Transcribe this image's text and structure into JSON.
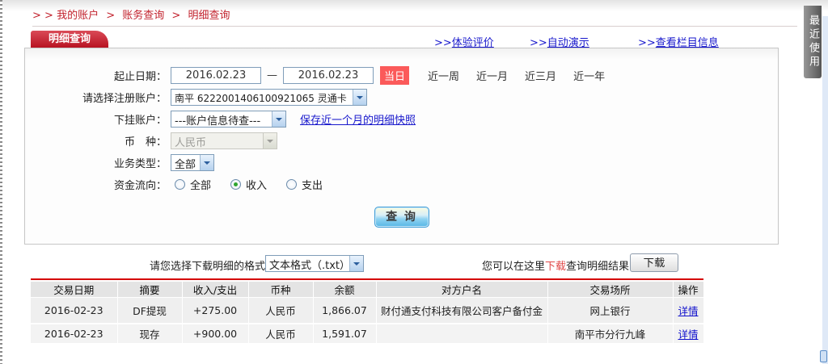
{
  "breadcrumb": {
    "prefix": "> >",
    "separator": ">",
    "items": [
      "我的账户",
      "账务查询",
      "明细查询"
    ]
  },
  "header": {
    "tab": "明细查询",
    "links": [
      {
        "prefix": ">>",
        "label": "体验评价"
      },
      {
        "prefix": ">>",
        "label": "自动演示"
      },
      {
        "prefix": ">>",
        "label": "查看栏目信息"
      }
    ]
  },
  "form": {
    "date": {
      "label": "起止日期：",
      "from": "2016.02.23",
      "dash": "—",
      "to": "2016.02.23",
      "today_badge": "当日",
      "ranges": [
        "近一周",
        "近一月",
        "近三月",
        "近一年"
      ]
    },
    "account": {
      "label": "请选择注册账户：",
      "value": "南平  6222001406100921065  灵通卡"
    },
    "sub_account": {
      "label": "下挂账户：",
      "value": "---账户信息待查---",
      "snapshot_link": "保存近一个月的明细快照"
    },
    "currency": {
      "label": "币　种：",
      "value": "人民币",
      "disabled": true
    },
    "biz_type": {
      "label": "业务类型：",
      "value": "全部"
    },
    "flow": {
      "label": "资金流向：",
      "options": [
        {
          "label": "全部",
          "checked": false
        },
        {
          "label": "收入",
          "checked": true
        },
        {
          "label": "支出",
          "checked": false
        }
      ]
    },
    "query_button": "查 询"
  },
  "download": {
    "format_label": "请您选择下载明细的格式",
    "format_value": "文本格式（.txt）",
    "hint_prefix": "您可以在这里",
    "hint_download": "下载",
    "hint_suffix": "查询明细结果",
    "button": "下载"
  },
  "table": {
    "headers": [
      "交易日期",
      "摘要",
      "收入/支出",
      "币种",
      "余额",
      "对方户名",
      "交易场所",
      "操作"
    ],
    "rows": [
      {
        "date": "2016-02-23",
        "summary": "DF提现",
        "amount": "+275.00",
        "currency": "人民币",
        "balance": "1,866.07",
        "counterparty": "财付通支付科技有限公司客户备付金",
        "place": "网上银行",
        "action": "详情"
      },
      {
        "date": "2016-02-23",
        "summary": "现存",
        "amount": "+900.00",
        "currency": "人民币",
        "balance": "1,591.07",
        "counterparty": "",
        "place": "南平市分行九峰",
        "action": "详情"
      }
    ]
  },
  "side": {
    "recent_tab": "最近使用"
  },
  "colors": {
    "brand_red": "#c2222d",
    "tab_red": "#b81322",
    "link_blue": "#1818cc",
    "badge_red": "#fb5a5a",
    "amount_red": "#fe0000",
    "table_header_bg": "#e4e4e4",
    "radio_checked_green": "#2fa52f"
  }
}
